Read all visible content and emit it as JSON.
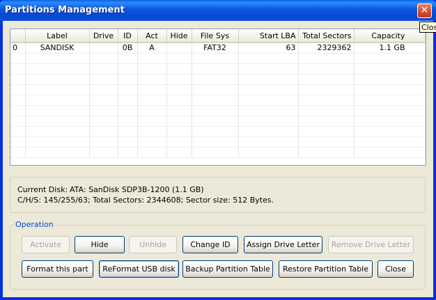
{
  "window": {
    "title": "Partitions Management",
    "close_tooltip": "Close"
  },
  "table": {
    "columns": [
      "",
      "Label",
      "Drive",
      "ID",
      "Act",
      "Hide",
      "File Sys",
      "Start LBA",
      "Total Sectors",
      "Capacity"
    ],
    "rows": [
      [
        "0",
        "SANDISK",
        "",
        "0B",
        "A",
        "",
        "FAT32",
        "63",
        "2329362",
        "1.1 GB"
      ]
    ]
  },
  "disk_info": {
    "current_disk_label": "Current Disk:",
    "current_disk_value": "ATA: SanDisk SDP3B-1200 (1.1 GB)",
    "chs_line": "C/H/S: 145/255/63; Total Sectors: 2344608; Sector size: 512 Bytes."
  },
  "operation": {
    "group_label": "Operation",
    "activate": "Activate",
    "hide": "Hide",
    "unhide": "Unhide",
    "change_id": "Change ID",
    "assign_drive_letter": "Assign Drive Letter",
    "remove_drive_letter": "Remove Drive Letter",
    "format_this_part": "Format this part",
    "reformat_usb_disk": "ReFormat USB disk",
    "backup_partition_table": "Backup Partition Table",
    "restore_partition_table": "Restore Partition Table",
    "close": "Close"
  }
}
